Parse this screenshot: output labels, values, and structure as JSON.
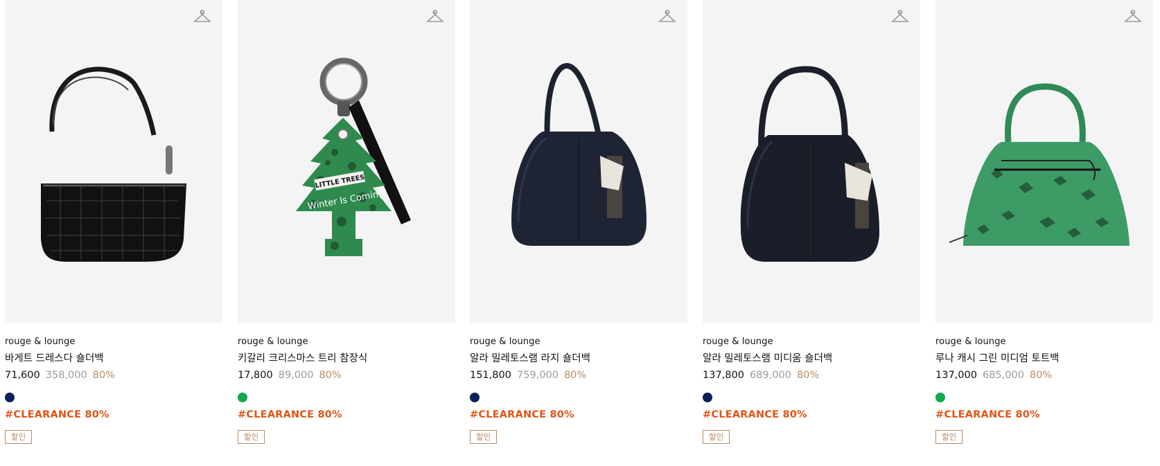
{
  "products": [
    {
      "brand": "rouge & lounge",
      "name": "바게트 드레스다 숄더백",
      "price": "71,600",
      "original_price": "358,000",
      "discount": "80%",
      "color_swatch": "#0d2157",
      "tag": "#CLEARANCE 80%",
      "badge": "할인",
      "image": "black-croc-baguette-bag",
      "wish_icon": "hanger-icon"
    },
    {
      "brand": "rouge & lounge",
      "name": "키갈리 크리스마스 트리 참장식",
      "price": "17,800",
      "original_price": "89,000",
      "discount": "80%",
      "color_swatch": "#12a84c",
      "tag": "#CLEARANCE 80%",
      "badge": "할인",
      "image": "green-tree-keyring",
      "image_text": [
        "LITTLE TREES",
        "Winter Is Coming"
      ],
      "wish_icon": "hanger-icon"
    },
    {
      "brand": "rouge & lounge",
      "name": "알라 밀레토스램 라지 숄더백",
      "price": "151,800",
      "original_price": "759,000",
      "discount": "80%",
      "color_swatch": "#0d2157",
      "tag": "#CLEARANCE 80%",
      "badge": "할인",
      "image": "navy-large-hobo-bag",
      "wish_icon": "hanger-icon"
    },
    {
      "brand": "rouge & lounge",
      "name": "알라 밀레토스램 미디움 숄더백",
      "price": "137,800",
      "original_price": "689,000",
      "discount": "80%",
      "color_swatch": "#0d2157",
      "tag": "#CLEARANCE 80%",
      "badge": "할인",
      "image": "navy-medium-hobo-bag",
      "wish_icon": "hanger-icon"
    },
    {
      "brand": "rouge & lounge",
      "name": "루나 캐시 그린 미디엄 토트백",
      "price": "137,000",
      "original_price": "685,000",
      "discount": "80%",
      "color_swatch": "#12a84c",
      "tag": "#CLEARANCE 80%",
      "badge": "할인",
      "image": "green-python-tote-bag",
      "wish_icon": "hanger-icon"
    }
  ]
}
